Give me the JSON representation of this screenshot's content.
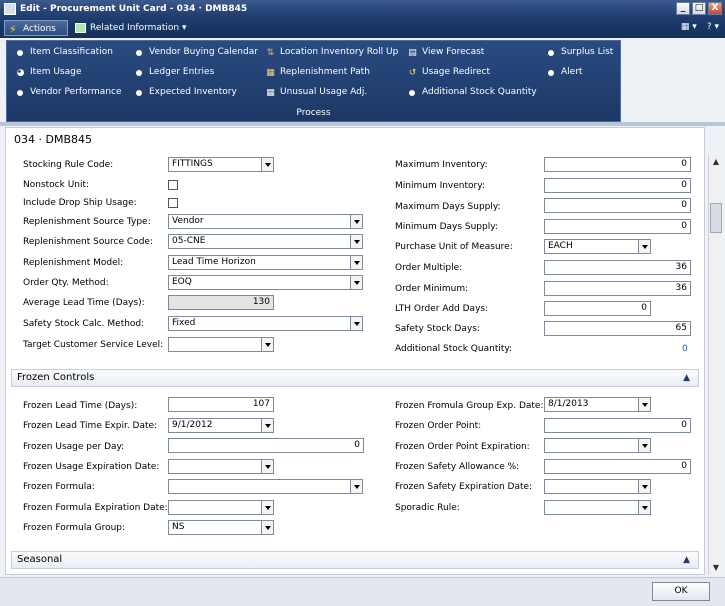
{
  "window": {
    "title": "Edit - Procurement Unit Card - 034 · DMB845",
    "min": "_",
    "max": "□",
    "close": "X"
  },
  "tabs": {
    "actions": "Actions",
    "related": "Related Information",
    "view": "▾",
    "help": "?"
  },
  "ribbon": {
    "items": [
      {
        "label": "Item Classification",
        "icon": "dot-icon"
      },
      {
        "label": "Item Usage",
        "icon": "usage-icon"
      },
      {
        "label": "Vendor Performance",
        "icon": "dot-icon"
      },
      {
        "label": "Vendor Buying Calendar",
        "icon": "dot-icon"
      },
      {
        "label": "Ledger Entries",
        "icon": "dot-icon"
      },
      {
        "label": "Expected Inventory",
        "icon": "dot-icon"
      },
      {
        "label": "Location Inventory Roll Up",
        "icon": "rollup-icon"
      },
      {
        "label": "Replenishment Path",
        "icon": "path-icon"
      },
      {
        "label": "Unusual Usage Adj.",
        "icon": "adjust-icon"
      },
      {
        "label": "View Forecast",
        "icon": "forecast-icon"
      },
      {
        "label": "Usage Redirect",
        "icon": "redirect-icon"
      },
      {
        "label": "Additional Stock Quantity",
        "icon": "dot-icon"
      },
      {
        "label": "Surplus List",
        "icon": "dot-icon"
      },
      {
        "label": "Alert",
        "icon": "dot-icon"
      }
    ],
    "group": "Process"
  },
  "page_title": "034 · DMB845",
  "general": {
    "left": [
      {
        "label": "Stocking Rule Code:",
        "value": "FITTINGS"
      },
      {
        "label": "Nonstock Unit:"
      },
      {
        "label": "Include Drop Ship Usage:"
      },
      {
        "label": "Replenishment Source Type:",
        "value": "Vendor"
      },
      {
        "label": "Replenishment Source Code:",
        "value": "05-CNE"
      },
      {
        "label": "Replenishment Model:",
        "value": "Lead Time Horizon"
      },
      {
        "label": "Order Qty. Method:",
        "value": "EOQ"
      },
      {
        "label": "Average Lead Time (Days):",
        "value": "130"
      },
      {
        "label": "Safety Stock Calc. Method:",
        "value": "Fixed"
      },
      {
        "label": "Target Customer Service Level:",
        "value": ""
      }
    ],
    "right": [
      {
        "label": "Maximum Inventory:",
        "value": "0"
      },
      {
        "label": "Minimum Inventory:",
        "value": "0"
      },
      {
        "label": "Maximum Days Supply:",
        "value": "0"
      },
      {
        "label": "Minimum Days Supply:",
        "value": "0"
      },
      {
        "label": "Purchase Unit of Measure:",
        "value": "EACH"
      },
      {
        "label": "Order Multiple:",
        "value": "36"
      },
      {
        "label": "Order Minimum:",
        "value": "36"
      },
      {
        "label": "LTH Order Add Days:",
        "value": "0"
      },
      {
        "label": "Safety Stock Days:",
        "value": "65"
      },
      {
        "label": "Additional Stock Quantity:",
        "value": "0"
      }
    ]
  },
  "frozen": {
    "header": "Frozen Controls",
    "left": [
      {
        "label": "Frozen Lead Time (Days):",
        "value": "107"
      },
      {
        "label": "Frozen Lead Time Expir. Date:",
        "value": "9/1/2012"
      },
      {
        "label": "Frozen Usage per Day:",
        "value": "0"
      },
      {
        "label": "Frozen Usage Expiration Date:",
        "value": ""
      },
      {
        "label": "Frozen Formula:",
        "value": ""
      },
      {
        "label": "Frozen Formula Expiration Date:",
        "value": ""
      },
      {
        "label": "Frozen Formula Group:",
        "value": "NS"
      }
    ],
    "right": [
      {
        "label": "Frozen Fromula Group Exp. Date:",
        "value": "8/1/2013"
      },
      {
        "label": "Frozen Order Point:",
        "value": "0"
      },
      {
        "label": "Frozen Order Point Expiration:",
        "value": ""
      },
      {
        "label": "Frozen Safety Allowance %:",
        "value": "0"
      },
      {
        "label": "Frozen Safety Expiration Date:",
        "value": ""
      },
      {
        "label": "Sporadic Rule:",
        "value": ""
      }
    ]
  },
  "seasonal": {
    "header": "Seasonal"
  },
  "footer": {
    "ok": "OK"
  },
  "colors": {
    "ribbon": "#1c3766",
    "link": "#1f5fb0"
  }
}
